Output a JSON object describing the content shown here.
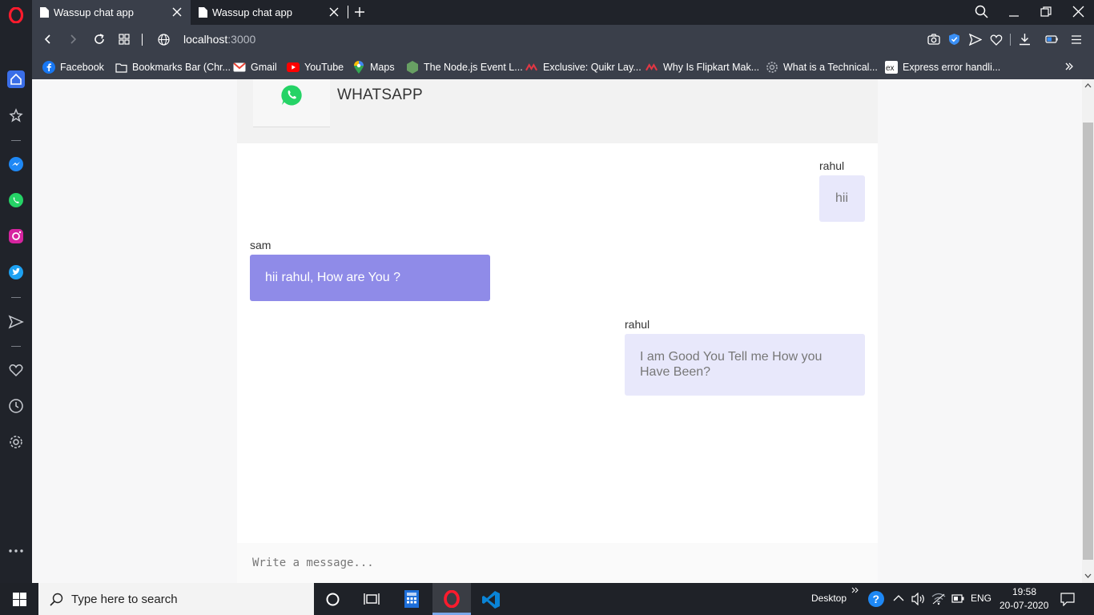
{
  "browser": {
    "tabs": [
      {
        "title": "Wassup chat app",
        "active": true
      },
      {
        "title": "Wassup chat app",
        "active": false
      }
    ],
    "url_host": "localhost",
    "url_port": ":3000",
    "bookmarks": [
      {
        "label": "Facebook",
        "icon": "facebook-icon"
      },
      {
        "label": "Bookmarks Bar (Chr...",
        "icon": "folder-icon"
      },
      {
        "label": "Gmail",
        "icon": "gmail-icon"
      },
      {
        "label": "YouTube",
        "icon": "youtube-icon"
      },
      {
        "label": "Maps",
        "icon": "maps-icon"
      },
      {
        "label": "The Node.js Event L...",
        "icon": "nodejs-icon"
      },
      {
        "label": "Exclusive: Quikr Lay...",
        "icon": "news-icon"
      },
      {
        "label": "Why Is Flipkart Mak...",
        "icon": "news-icon"
      },
      {
        "label": "What is a Technical...",
        "icon": "gear-icon"
      },
      {
        "label": "Express error handli...",
        "icon": "express-icon"
      }
    ]
  },
  "app": {
    "brand": "WHATSAPP",
    "messages": [
      {
        "sender": "rahul",
        "text": "hii",
        "mine": true
      },
      {
        "sender": "sam",
        "text": "hii rahul, How are You ?",
        "mine": false
      },
      {
        "sender": "rahul",
        "text": "I am Good You Tell me How you Have Been?",
        "mine": true
      }
    ],
    "composer_placeholder": "Write a message..."
  },
  "taskbar": {
    "search_placeholder": "Type here to search",
    "desktop_label": "Desktop",
    "language": "ENG",
    "time": "19:58",
    "date": "20-07-2020"
  },
  "colors": {
    "my_bubble": "#e8e8fb",
    "their_bubble": "#8f8be8",
    "whatsapp_green": "#25d366"
  }
}
